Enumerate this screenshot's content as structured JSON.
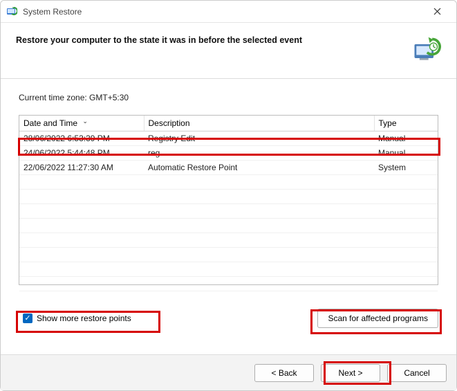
{
  "window": {
    "title": "System Restore"
  },
  "header": {
    "heading": "Restore your computer to the state it was in before the selected event"
  },
  "timezone_label": "Current time zone: GMT+5:30",
  "columns": {
    "datetime": "Date and Time",
    "description": "Description",
    "type": "Type"
  },
  "rows": [
    {
      "datetime": "28/06/2022 6:53:39 PM",
      "description": "Registry Edit",
      "type": "Manual"
    },
    {
      "datetime": "24/06/2022 5:44:48 PM",
      "description": "reg",
      "type": "Manual"
    },
    {
      "datetime": "22/06/2022 11:27:30 AM",
      "description": "Automatic Restore Point",
      "type": "System"
    }
  ],
  "checkbox": {
    "label": "Show more restore points",
    "checked": true
  },
  "buttons": {
    "scan": "Scan for affected programs",
    "back": "< Back",
    "next": "Next >",
    "cancel": "Cancel"
  }
}
